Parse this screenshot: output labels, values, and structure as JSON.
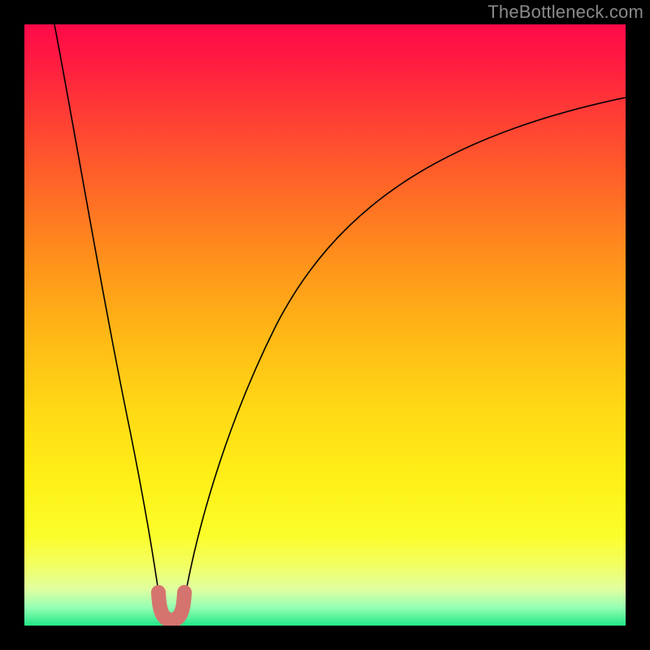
{
  "watermark": "TheBottleneck.com",
  "chart_data": {
    "type": "line",
    "title": "",
    "xlabel": "",
    "ylabel": "",
    "xlim": [
      0,
      100
    ],
    "ylim": [
      0,
      100
    ],
    "background_gradient": {
      "direction": "vertical",
      "stops": [
        {
          "pos": 0.0,
          "color": "#ff0a4a"
        },
        {
          "pos": 0.15,
          "color": "#ff3d35"
        },
        {
          "pos": 0.4,
          "color": "#ff941b"
        },
        {
          "pos": 0.64,
          "color": "#ffd915"
        },
        {
          "pos": 0.85,
          "color": "#fbfd2a"
        },
        {
          "pos": 0.97,
          "color": "#94ffb4"
        },
        {
          "pos": 1.0,
          "color": "#22e787"
        }
      ]
    },
    "series": [
      {
        "name": "left-branch",
        "stroke": "#000000",
        "stroke_width": 1.5,
        "points": [
          {
            "x": 5.0,
            "y": 100.0
          },
          {
            "x": 7.0,
            "y": 86.0
          },
          {
            "x": 10.0,
            "y": 67.0
          },
          {
            "x": 13.0,
            "y": 50.0
          },
          {
            "x": 16.0,
            "y": 34.0
          },
          {
            "x": 18.0,
            "y": 23.0
          },
          {
            "x": 20.0,
            "y": 13.0
          },
          {
            "x": 21.5,
            "y": 6.0
          },
          {
            "x": 22.7,
            "y": 1.5
          }
        ]
      },
      {
        "name": "right-branch",
        "stroke": "#000000",
        "stroke_width": 1.5,
        "points": [
          {
            "x": 26.3,
            "y": 1.5
          },
          {
            "x": 28.0,
            "y": 8.0
          },
          {
            "x": 31.0,
            "y": 20.0
          },
          {
            "x": 35.0,
            "y": 33.0
          },
          {
            "x": 40.0,
            "y": 45.0
          },
          {
            "x": 47.0,
            "y": 57.0
          },
          {
            "x": 55.0,
            "y": 66.0
          },
          {
            "x": 64.0,
            "y": 73.5
          },
          {
            "x": 74.0,
            "y": 79.5
          },
          {
            "x": 85.0,
            "y": 84.0
          },
          {
            "x": 100.0,
            "y": 88.0
          }
        ]
      },
      {
        "name": "valley-marker",
        "stroke": "#d5746f",
        "stroke_width": 14,
        "linecap": "round",
        "points": [
          {
            "x": 22.5,
            "y": 5.0
          },
          {
            "x": 23.0,
            "y": 1.5
          },
          {
            "x": 24.5,
            "y": 0.7
          },
          {
            "x": 26.0,
            "y": 1.5
          },
          {
            "x": 26.5,
            "y": 5.0
          }
        ]
      }
    ]
  }
}
